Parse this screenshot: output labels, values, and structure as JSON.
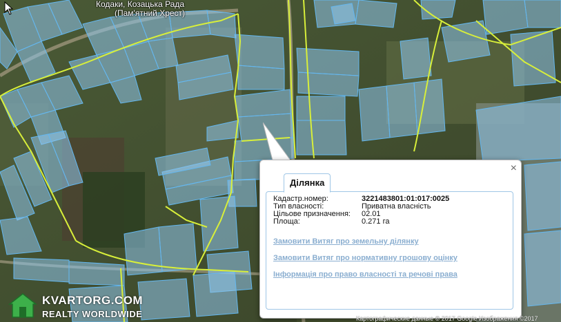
{
  "map": {
    "place_label_line1": "Кодаки, Козацька Рада",
    "place_label_line2": "(Пам'ятний Хрест)",
    "copyright": "Картографические данные © 2017 Google Изображения ©2017"
  },
  "popup": {
    "tab_label": "Ділянка",
    "close_icon": "×",
    "properties": [
      {
        "label": "Кадастр.номер:",
        "value": "3221483801:01:017:0025"
      },
      {
        "label": "Тип власності:",
        "value": "Приватна власність"
      },
      {
        "label": "Цільове призначення:",
        "value": "02.01"
      },
      {
        "label": "Площа:",
        "value": "0.271 га"
      }
    ],
    "links": [
      "Замовити Витяг про земельну ділянку",
      "Замовити Витяг про нормативну грошову оцінку",
      "Інформація про право власності та речові права"
    ]
  },
  "watermark": {
    "brand": "KVARTORG.COM",
    "tagline": "REALTY WORLDWIDE",
    "icon": "house-icon"
  },
  "colors": {
    "parcel_fill": "#8fc6ec",
    "parcel_stroke": "#5fb3ee",
    "boundary": "#d8ef3a",
    "link": "#8aaed0"
  }
}
